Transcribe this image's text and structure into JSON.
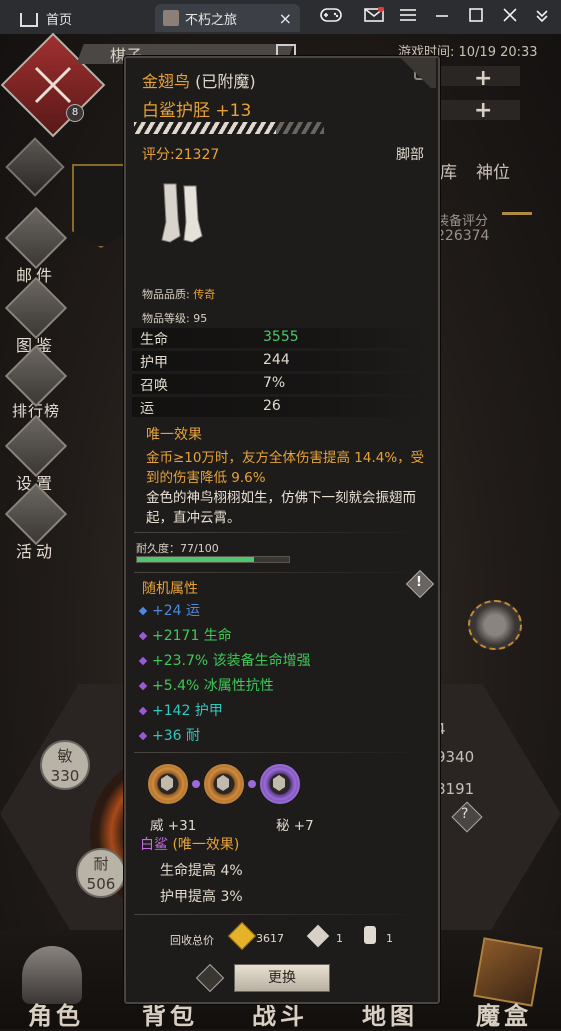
{
  "browser": {
    "home_tab": "首页",
    "game_tab": "不朽之旅",
    "close": "×"
  },
  "game": {
    "play_time": "游戏时间: 10/19 20:33",
    "player_name_partial": "棋子",
    "level_badge": "8",
    "tabs_partial": [
      "库",
      "神位"
    ],
    "equip_score_label": "装备评分",
    "equip_score_value": "226374",
    "side_menu": [
      "邮件",
      "图鉴",
      "排行榜",
      "设置",
      "活动"
    ],
    "attr_left": [
      {
        "label": "敏",
        "value": "330"
      },
      {
        "label": "耐",
        "value": "506"
      }
    ],
    "right_values": [
      "4",
      "9340",
      "8191"
    ],
    "bottom_nav": [
      "角色",
      "背包",
      "战斗",
      "地图",
      "魔盒"
    ]
  },
  "item": {
    "owner": "金翅鸟",
    "enchant": "(已附魔)",
    "name": "白鲨护胫 +13",
    "score": "评分:21327",
    "slot": "脚部",
    "quality_label": "物品品质:",
    "quality": "传奇",
    "level_label": "物品等级:",
    "level": "95",
    "stats": [
      {
        "name": "生命",
        "value": "3555",
        "color": "#4cc86a"
      },
      {
        "name": "护甲",
        "value": "244",
        "color": "#e0d8cc"
      },
      {
        "name": "召唤",
        "value": "7%",
        "color": "#e0d8cc"
      },
      {
        "name": "运",
        "value": "26",
        "color": "#e0d8cc"
      }
    ],
    "unique_title": "唯一效果",
    "unique_text": "金币≥10万时，友方全体伤害提高 14.4%，受到的伤害降低 9.6%",
    "flavor": "金色的神鸟栩栩如生，仿佛下一刻就会振翅而起，直冲云霄。",
    "durability": "耐久度：77/100",
    "durability_fraction": 0.77,
    "random_title": "随机属性",
    "random": [
      {
        "text": "+24 运",
        "color": "#4c8ae0"
      },
      {
        "text": "+2171 生命",
        "color": "#3ec85a"
      },
      {
        "text": "+23.7% 该装备生命增强",
        "color": "#3ec85a"
      },
      {
        "text": "+5.4% 冰属性抗性",
        "color": "#3ec85a"
      },
      {
        "text": "+142 护甲",
        "color": "#2fc8c0"
      },
      {
        "text": "+36 耐",
        "color": "#2fc8c0"
      }
    ],
    "gem_left": "威 +31",
    "gem_right": "秘 +7",
    "set_name": "白鲨",
    "set_suffix": "(唯一效果)",
    "set_bonus": [
      "生命提高 4%",
      "护甲提高 3%"
    ],
    "recycle_label": "回收总价",
    "recycle_gold": "3617",
    "recycle_a": "1",
    "recycle_b": "1",
    "replace": "更换",
    "accent_gold": "#e6a23a",
    "accent_purple": "#c46ae0"
  }
}
